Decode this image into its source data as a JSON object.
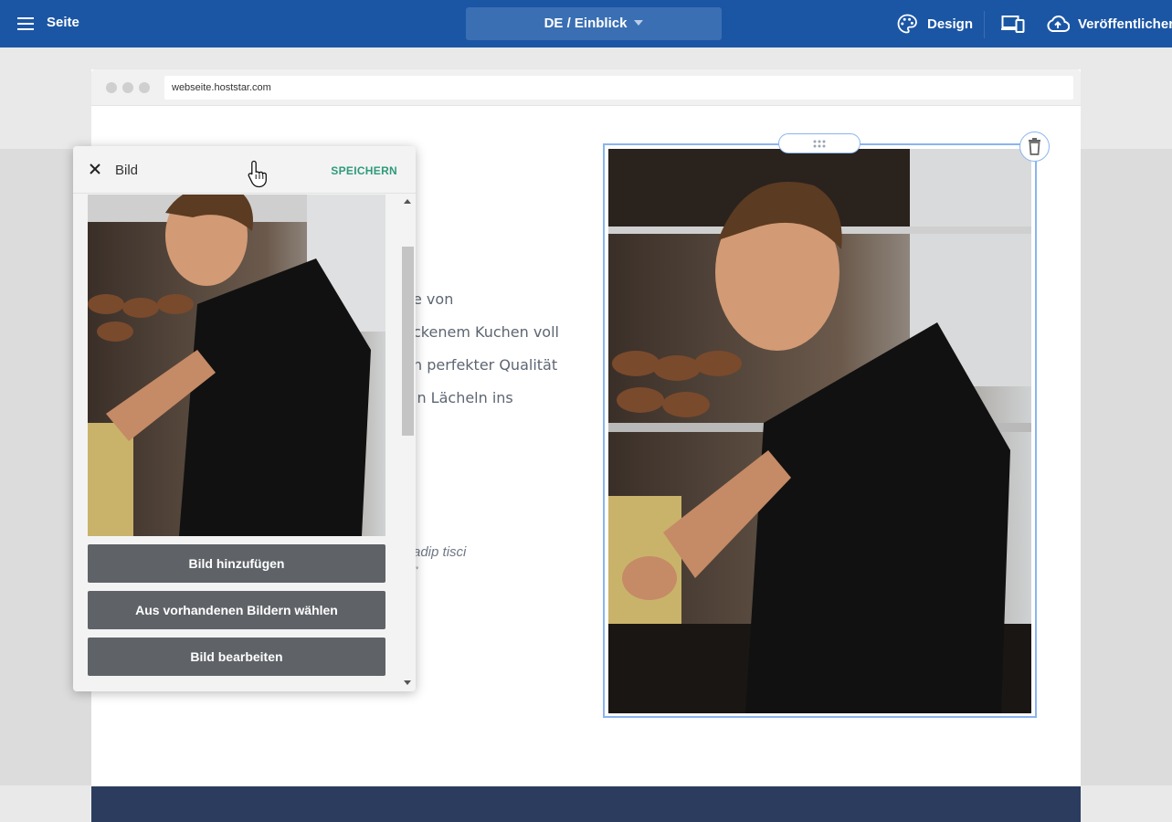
{
  "topbar": {
    "page_label": "Seite",
    "language": "DE / Einblick",
    "design_label": "Design",
    "publish_label": "Veröffentlichen"
  },
  "browser": {
    "url": "webseite.hoststar.com"
  },
  "content": {
    "lines": [
      "e von",
      "ckenem Kuchen voll",
      "n perfekter Qualität",
      "in Lächeln ins"
    ],
    "quote_line1": "adip tisci",
    "quote_line2": "\""
  },
  "panel": {
    "title": "Bild",
    "save_label": "SPEICHERN",
    "buttons": [
      "Bild hinzufügen",
      "Aus vorhandenen Bildern wählen",
      "Bild bearbeiten"
    ]
  },
  "colors": {
    "topbar": "#1b56a5",
    "selection": "#8ab4ee",
    "save_accent": "#2e9a7a",
    "footer": "#2b3c5e"
  }
}
